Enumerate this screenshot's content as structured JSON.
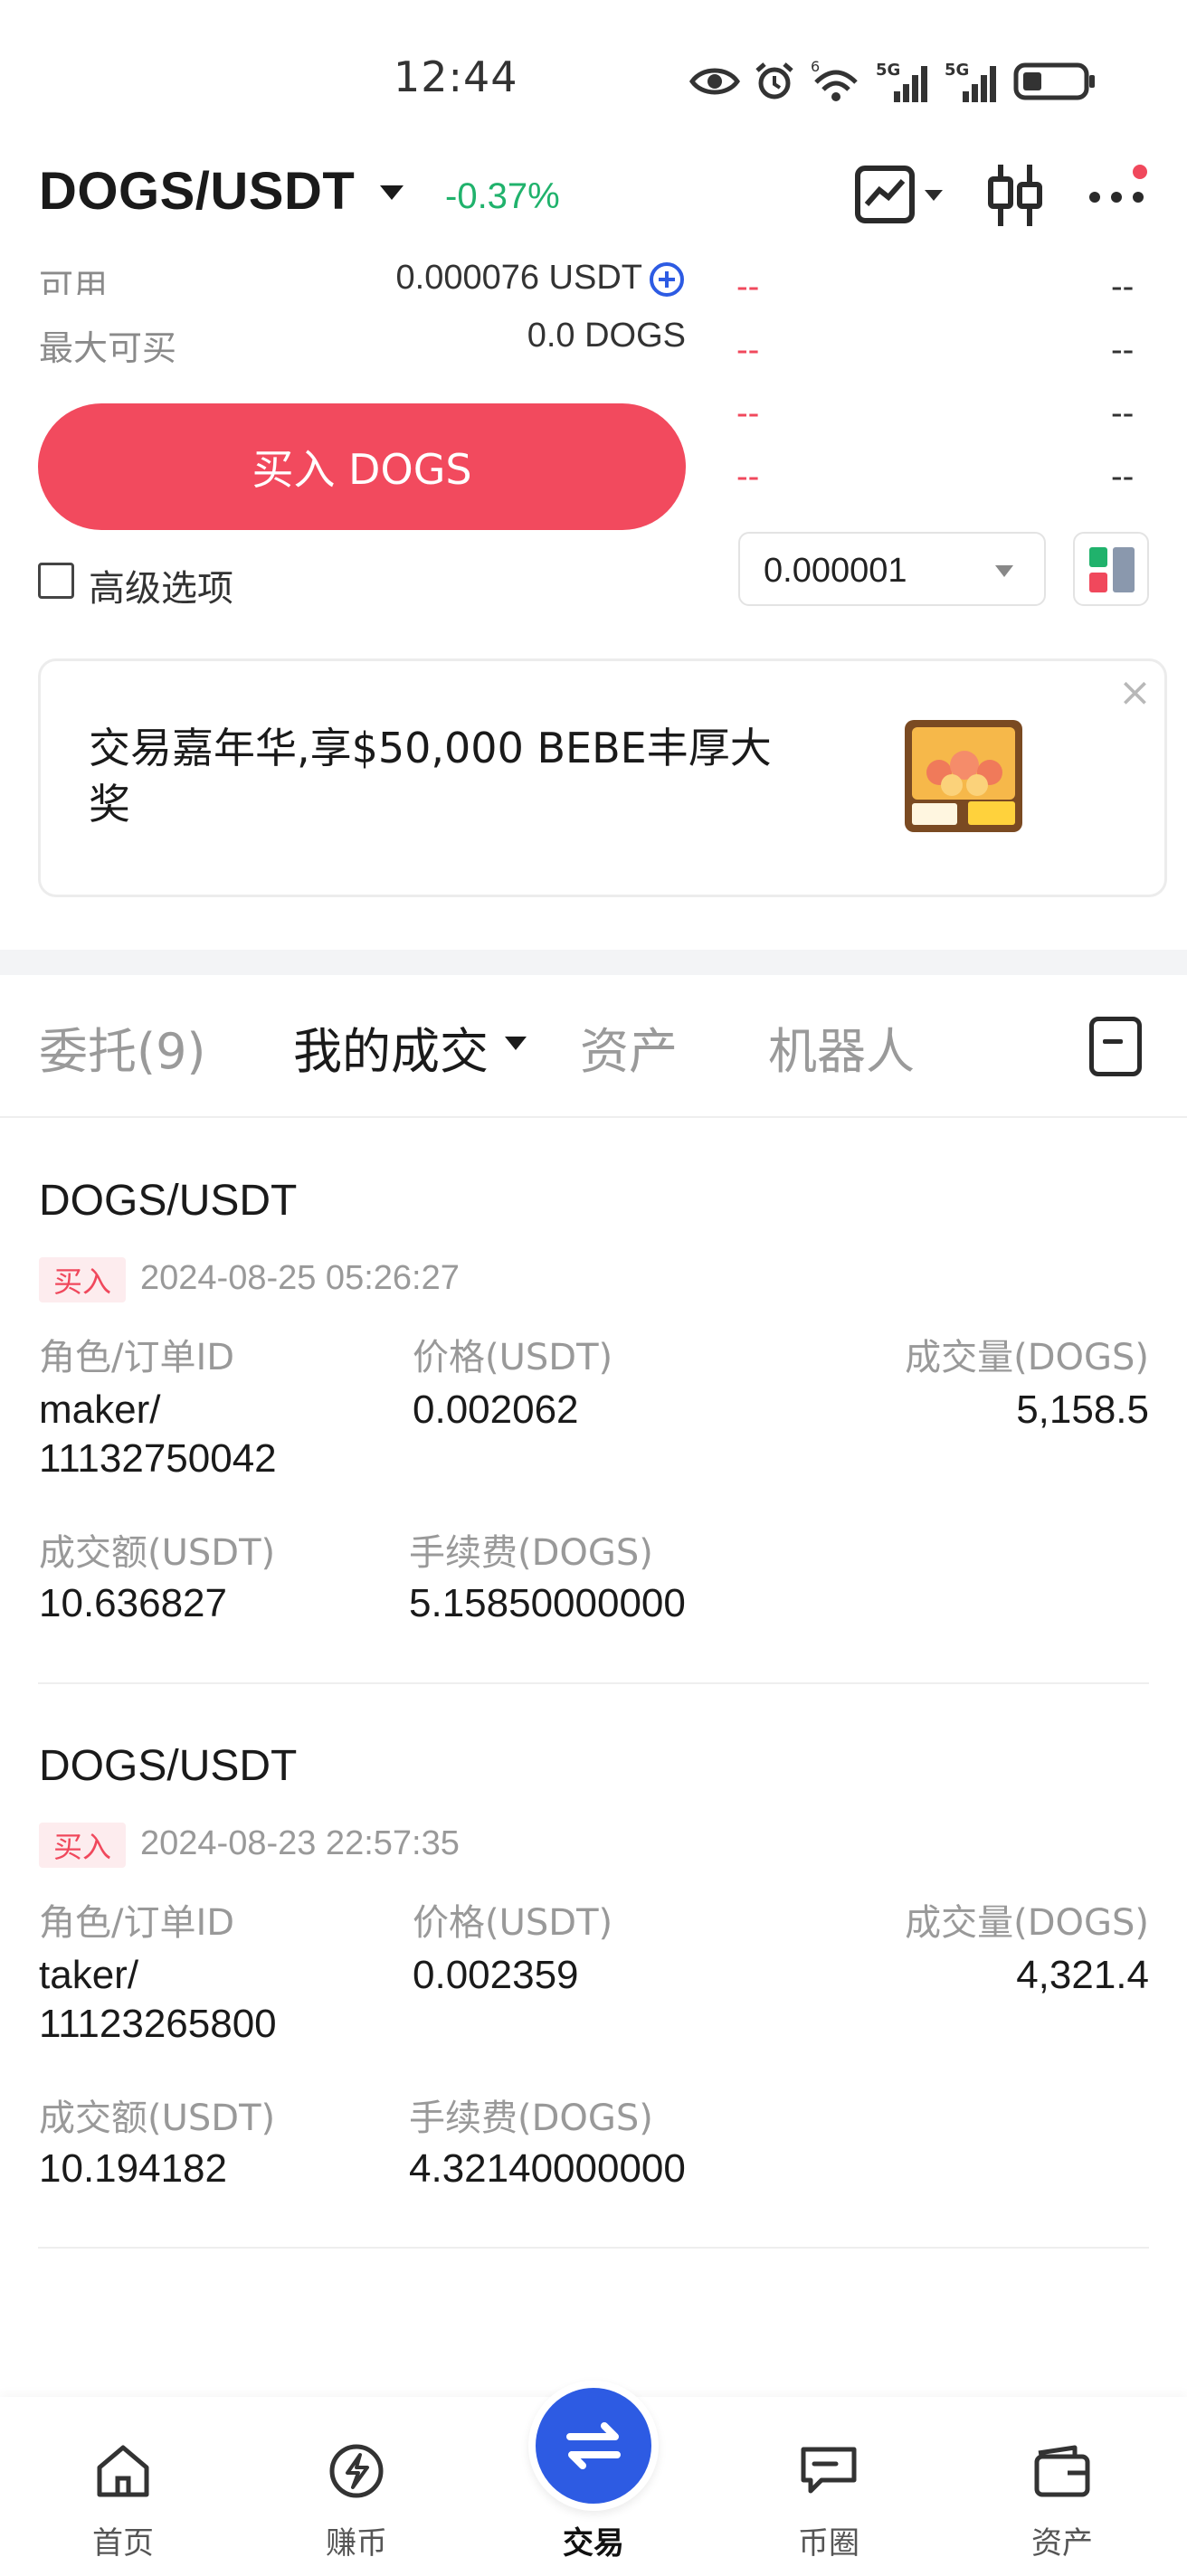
{
  "status_bar": {
    "time": "12:44",
    "icons": [
      "eye-icon",
      "alarm-icon",
      "wifi-icon",
      "signal-5g-icon",
      "signal-5g-icon",
      "battery-icon"
    ],
    "network_labels": [
      "5G",
      "5G"
    ],
    "wifi_label": "6"
  },
  "header": {
    "pair": "DOGS/USDT",
    "change": "-0.37%",
    "change_color": "#20b26c",
    "icons": [
      "chart-switch-icon",
      "candlestick-icon",
      "more-icon"
    ]
  },
  "order_panel": {
    "available_label": "可用",
    "available_value": "0.000076 USDT",
    "max_buy_label": "最大可买",
    "max_buy_value": "0.0 DOGS",
    "buy_button": "买入 DOGS",
    "buy_color": "#f24a5e",
    "advanced_label": "高级选项",
    "orderbook_rows": [
      {
        "price": "--",
        "qty": "--"
      },
      {
        "price": "--",
        "qty": "--"
      },
      {
        "price": "--",
        "qty": "--"
      },
      {
        "price": "--",
        "qty": "--"
      }
    ],
    "precision_value": "0.000001"
  },
  "banner": {
    "text": "交易嘉年华,享$50,000 BEBE丰厚大奖",
    "close": "×"
  },
  "tabs": [
    {
      "label": "委托(9)"
    },
    {
      "label": "我的成交"
    },
    {
      "label": "资产"
    },
    {
      "label": "机器人"
    }
  ],
  "trades": [
    {
      "pair": "DOGS/USDT",
      "side": "买入",
      "time": "2024-08-25 05:26:27",
      "role_label": "角色/订单ID",
      "role_value": "maker/",
      "order_id": "11132750042",
      "price_label": "价格(USDT)",
      "price_value": "0.002062",
      "qty_label": "成交量(DOGS)",
      "qty_value": "5,158.5",
      "amount_label": "成交额(USDT)",
      "amount_value": "10.636827",
      "fee_label": "手续费(DOGS)",
      "fee_value": "5.15850000000"
    },
    {
      "pair": "DOGS/USDT",
      "side": "买入",
      "time": "2024-08-23 22:57:35",
      "role_label": "角色/订单ID",
      "role_value": "taker/",
      "order_id": "11123265800",
      "price_label": "价格(USDT)",
      "price_value": "0.002359",
      "qty_label": "成交量(DOGS)",
      "qty_value": "4,321.4",
      "amount_label": "成交额(USDT)",
      "amount_value": "10.194182",
      "fee_label": "手续费(DOGS)",
      "fee_value": "4.32140000000"
    }
  ],
  "bottom_nav": [
    {
      "label": "首页",
      "icon": "home-icon"
    },
    {
      "label": "赚币",
      "icon": "earn-icon"
    },
    {
      "label": "交易",
      "icon": "trade-swap-icon"
    },
    {
      "label": "币圈",
      "icon": "chat-icon"
    },
    {
      "label": "资产",
      "icon": "wallet-icon"
    }
  ],
  "accent_blue": "#2d5be3"
}
